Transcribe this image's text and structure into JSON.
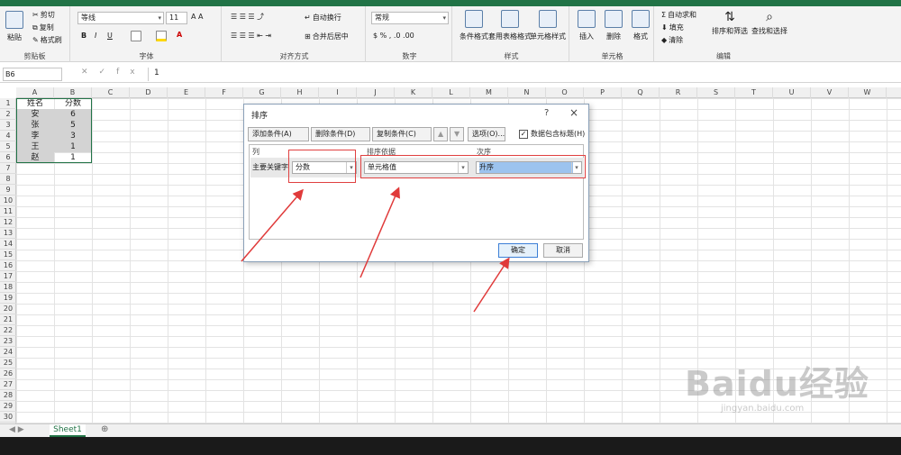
{
  "ribbon": {
    "clipboard": {
      "label": "剪贴板",
      "paste": "粘贴",
      "cut": "剪切",
      "copy": "复制",
      "painter": "格式刷"
    },
    "font": {
      "label": "字体",
      "name": "等线",
      "size": "11",
      "bold": "B",
      "italic": "I",
      "underline": "U"
    },
    "align": {
      "label": "对齐方式",
      "wrap": "自动换行",
      "merge": "合并后居中"
    },
    "number": {
      "label": "数字",
      "format": "常规"
    },
    "styles": {
      "label": "样式",
      "cond": "条件格式",
      "table": "套用表格格式",
      "cell": "单元格样式"
    },
    "cells": {
      "label": "单元格",
      "insert": "插入",
      "delete": "删除",
      "format": "格式"
    },
    "edit": {
      "label": "编辑",
      "autosum": "自动求和",
      "fill": "填充",
      "clear": "清除",
      "sort": "排序和筛选",
      "find": "查找和选择"
    }
  },
  "formula_bar": {
    "name_box": "B6",
    "fx": "fx",
    "value": "1"
  },
  "columns": [
    "A",
    "B",
    "C",
    "D",
    "E",
    "F",
    "G",
    "H",
    "I",
    "J",
    "K",
    "L",
    "M",
    "N",
    "O",
    "P",
    "Q",
    "R",
    "S",
    "T",
    "U",
    "V",
    "W"
  ],
  "rows": [
    "1",
    "2",
    "3",
    "4",
    "5",
    "6",
    "7",
    "8",
    "9",
    "10",
    "11",
    "12",
    "13",
    "14",
    "15",
    "16",
    "17",
    "18",
    "19",
    "20",
    "21",
    "22",
    "23",
    "24",
    "25",
    "26",
    "27",
    "28",
    "29",
    "30"
  ],
  "cells": [
    [
      "姓名",
      "分数"
    ],
    [
      "安",
      "6"
    ],
    [
      "张",
      "5"
    ],
    [
      "李",
      "3"
    ],
    [
      "王",
      "1"
    ],
    [
      "赵",
      "1"
    ]
  ],
  "sheet_tab": "Sheet1",
  "dialog": {
    "title": "排序",
    "help": "?",
    "close": "×",
    "add": "添加条件(A)",
    "del": "删除条件(D)",
    "copy": "复制条件(C)",
    "options": "选项(O)...",
    "has_header": "数据包含标题(H)",
    "col_hdr": "列",
    "basis_hdr": "排序依据",
    "order_hdr": "次序",
    "key_label": "主要关键字",
    "key_value": "分数",
    "basis_value": "单元格值",
    "order_value": "升序",
    "ok": "确定",
    "cancel": "取消"
  },
  "watermark": {
    "brand": "Baidu经验",
    "url": "jingyan.baidu.com"
  }
}
